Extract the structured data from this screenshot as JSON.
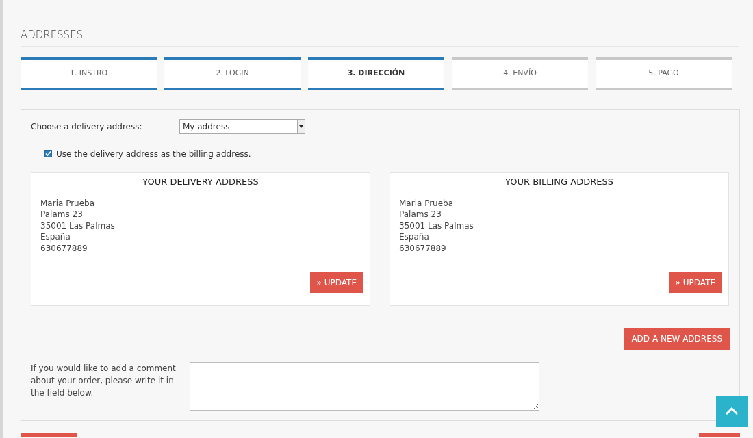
{
  "page_title": "ADDRESSES",
  "steps": [
    {
      "label": "1. INSTRO",
      "completed": true,
      "selected": false
    },
    {
      "label": "2. LOGIN",
      "completed": true,
      "selected": false
    },
    {
      "label": "3. DIRECCIÓN",
      "completed": true,
      "selected": true
    },
    {
      "label": "4. ENVÍO",
      "completed": false,
      "selected": false
    },
    {
      "label": "5. PAGO",
      "completed": false,
      "selected": false
    }
  ],
  "address_select": {
    "label": "Choose a delivery address:",
    "value": "My address"
  },
  "same_billing": {
    "label": "Use the delivery address as the billing address.",
    "checked": true
  },
  "address_cards": [
    {
      "title": "YOUR DELIVERY ADDRESS",
      "lines": [
        "Maria Prueba",
        "Palams 23",
        "35001 Las Palmas",
        "España",
        "630677889"
      ],
      "button": "» UPDATE"
    },
    {
      "title": "YOUR BILLING ADDRESS",
      "lines": [
        "Maria Prueba",
        "Palams 23",
        "35001 Las Palmas",
        "España",
        "630677889"
      ],
      "button": "» UPDATE"
    }
  ],
  "add_address_button": "ADD A NEW ADDRESS",
  "comment": {
    "label": "If you would like to add a comment about your order, please write it in the field below."
  }
}
